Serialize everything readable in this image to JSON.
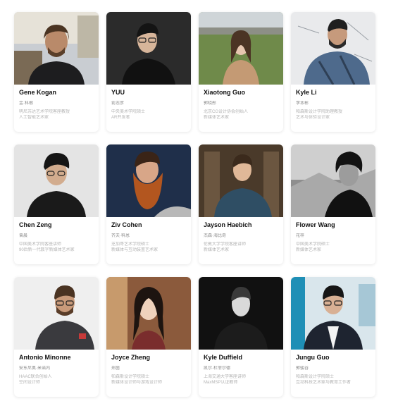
{
  "people": [
    {
      "name": "Gene Kogan",
      "cn": "金·科根",
      "desc1": "明尼苏达艺术学院客座教授",
      "desc2": "人工智能艺术家"
    },
    {
      "name": "YUU",
      "cn": "俞志彦",
      "desc1": "中央美术学院硕士",
      "desc2": "AR开发者"
    },
    {
      "name": "Xiaotong Guo",
      "cn": "郭晓彤",
      "desc1": "北京CG设计协会创始人",
      "desc2": "新媒体艺术家"
    },
    {
      "name": "Kyle Li",
      "cn": "李本彬",
      "desc1": "帕森斯设计学院助理教授",
      "desc2": "艺术与体验设计家"
    },
    {
      "name": "Chen Zeng",
      "cn": "曾晨",
      "desc1": "中国美术学院客座讲师",
      "desc2": "90后新一代数字新媒体艺术家"
    },
    {
      "name": "Ziv Cohen",
      "cn": "齐夫·科恩",
      "desc1": "芝加哥艺术学院硕士",
      "desc2": "新媒体与互动装置艺术家"
    },
    {
      "name": "Jayson Haebich",
      "cn": "杰森·海比奇",
      "desc1": "伦敦大学学院客座讲师",
      "desc2": "新媒体艺术家"
    },
    {
      "name": "Flower Wang",
      "cn": "花梓",
      "desc1": "中国美术学院硕士",
      "desc2": "新媒体艺术家"
    },
    {
      "name": "Antonio Minonne",
      "cn": "安东尼奥·米诺内",
      "desc1": "HAAC联合创始人",
      "desc2": "空间设计师"
    },
    {
      "name": "Joyce Zheng",
      "cn": "郑茵",
      "desc1": "帕森斯设计学院硕士",
      "desc2": "新媒体设计师与游戏设计师"
    },
    {
      "name": "Kyle Duffield",
      "cn": "凯尔·杜菲尔德",
      "desc1": "上海交通大学客座讲师",
      "desc2": "MaxMSP认证教师"
    },
    {
      "name": "Jungu Guo",
      "cn": "郭骏谷",
      "desc1": "帕森斯设计学院硕士",
      "desc2": "互动科技艺术家与教育工作者"
    }
  ]
}
